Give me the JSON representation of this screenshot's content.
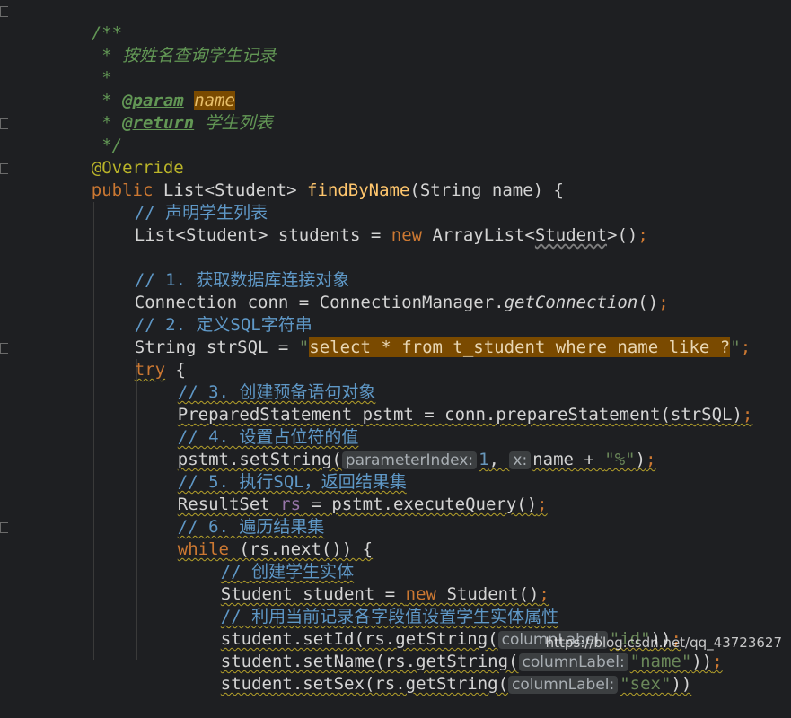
{
  "code": {
    "doc_open": "/**",
    "doc_line1": " * 按姓名查询学生记录",
    "doc_line2": " *",
    "doc_param_tag": "@param",
    "doc_param_name": "name",
    "doc_return_tag": "@return",
    "doc_return_text": "学生列表",
    "doc_close": " */",
    "annotation": "@Override",
    "sig_public": "public",
    "sig_type": " List<Student> ",
    "sig_method": "findByName",
    "sig_params": "(String name) {",
    "c_declare": "// 声明学生列表",
    "list_decl_left": "List<Student> students = ",
    "list_new": "new",
    "list_decl_mid": " ArrayList<",
    "list_generic": "Student",
    "list_decl_right": ">()",
    "semicolon": ";",
    "c_step1": "// 1. 获取数据库连接对象",
    "conn_left": "Connection conn = ConnectionManager.",
    "conn_method": "getConnection",
    "conn_right": "()",
    "c_step2": "// 2. 定义SQL字符串",
    "sql_left": "String strSQL = ",
    "quote": "\"",
    "sql_text": "select * from t_student where name like ?",
    "try_kw": "try",
    "try_brace": " {",
    "c_step3": "// 3. 创建预备语句对象",
    "ps_line": "PreparedStatement pstmt = conn.prepareStatement(strSQL)",
    "c_step4": "// 4. 设置占位符的值",
    "set_left": "pstmt.setString(",
    "hint_param_index": "parameterIndex:",
    "set_num": "1",
    "set_comma": ", ",
    "hint_x": "x:",
    "set_name": "name + ",
    "set_pct": "\"%\"",
    "set_right": ")",
    "c_step5": "// 5. 执行SQL，返回结果集",
    "rs_left": "ResultSet ",
    "rs_var": "rs",
    "rs_right": " = pstmt.executeQuery()",
    "c_step6": "// 6. 遍历结果集",
    "while_kw": "while",
    "while_rest": " (rs.next()) {",
    "c_create": "// 创建学生实体",
    "student_left": "Student student = ",
    "student_new": "new",
    "student_right": " Student()",
    "c_fill": "// 利用当前记录各字段值设置学生实体属性",
    "setid_left": "student.setId(rs.getString(",
    "hint_column_label": "columnLabel:",
    "setid_str": "\"id\"",
    "setid_right": "))",
    "setname_left": "student.setName(rs.getString(",
    "setname_str": "\"name\"",
    "setname_right": "))",
    "setsex_partial": "student.setSex(rs.getString(",
    "setsex_str": "\"sex\"",
    "setsex_right": "))"
  },
  "watermark": "https://blog.csdn.net/qq_43723627",
  "colors": {
    "background": "#1e1f22",
    "keyword": "#cc7832",
    "comment": "#5f98c7",
    "doc_comment": "#629755",
    "string": "#6a8759",
    "highlight": "#7a4a00"
  }
}
